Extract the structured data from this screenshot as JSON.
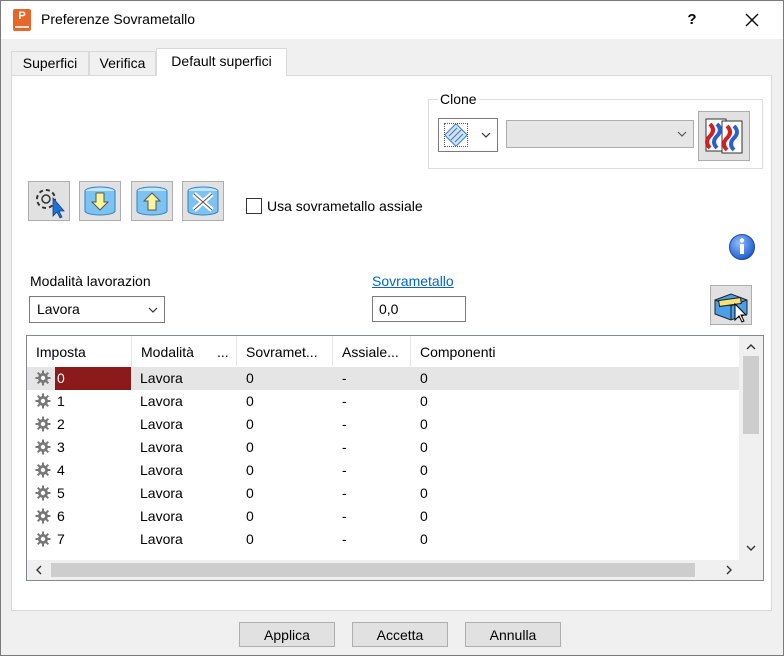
{
  "window": {
    "title": "Preferenze Sovrametallo",
    "help_label": "?",
    "close_label": "✕",
    "app_icon_letter": "P"
  },
  "tabs": [
    {
      "label": "Superfici",
      "active": false
    },
    {
      "label": "Verifica",
      "active": false
    },
    {
      "label": "Default superfici",
      "active": true
    }
  ],
  "clone": {
    "legend": "Clone",
    "type_icon": "hatch-pattern-icon",
    "selected_value": ""
  },
  "toolbar_icons": [
    "select-settings-icon",
    "import-down-icon",
    "export-up-icon",
    "clear-settings-icon"
  ],
  "axial_checkbox": {
    "label": "Usa sovrametallo assiale",
    "checked": false
  },
  "modalita": {
    "label": "Modalità lavorazion",
    "value": "Lavora"
  },
  "sovrametallo": {
    "label": "Sovrametallo",
    "value": "0,0"
  },
  "grid": {
    "columns": [
      "Imposta",
      "Modalità",
      "...",
      "Sovramet...",
      "Assiale...",
      "Componenti"
    ],
    "rows": [
      {
        "imposta": "0",
        "modalita": "Lavora",
        "sovr": "0",
        "assiale": "-",
        "comp": "0"
      },
      {
        "imposta": "1",
        "modalita": "Lavora",
        "sovr": "0",
        "assiale": "-",
        "comp": "0"
      },
      {
        "imposta": "2",
        "modalita": "Lavora",
        "sovr": "0",
        "assiale": "-",
        "comp": "0"
      },
      {
        "imposta": "3",
        "modalita": "Lavora",
        "sovr": "0",
        "assiale": "-",
        "comp": "0"
      },
      {
        "imposta": "4",
        "modalita": "Lavora",
        "sovr": "0",
        "assiale": "-",
        "comp": "0"
      },
      {
        "imposta": "5",
        "modalita": "Lavora",
        "sovr": "0",
        "assiale": "-",
        "comp": "0"
      },
      {
        "imposta": "6",
        "modalita": "Lavora",
        "sovr": "0",
        "assiale": "-",
        "comp": "0"
      },
      {
        "imposta": "7",
        "modalita": "Lavora",
        "sovr": "0",
        "assiale": "-",
        "comp": "0"
      }
    ],
    "selected_row": 0
  },
  "buttons": {
    "apply": "Applica",
    "accept": "Accetta",
    "cancel": "Annulla"
  },
  "colors": {
    "link": "#0066cc",
    "selection": "#8b1a1a",
    "app_icon": "#e8662a",
    "info": "#2e6fd8"
  }
}
